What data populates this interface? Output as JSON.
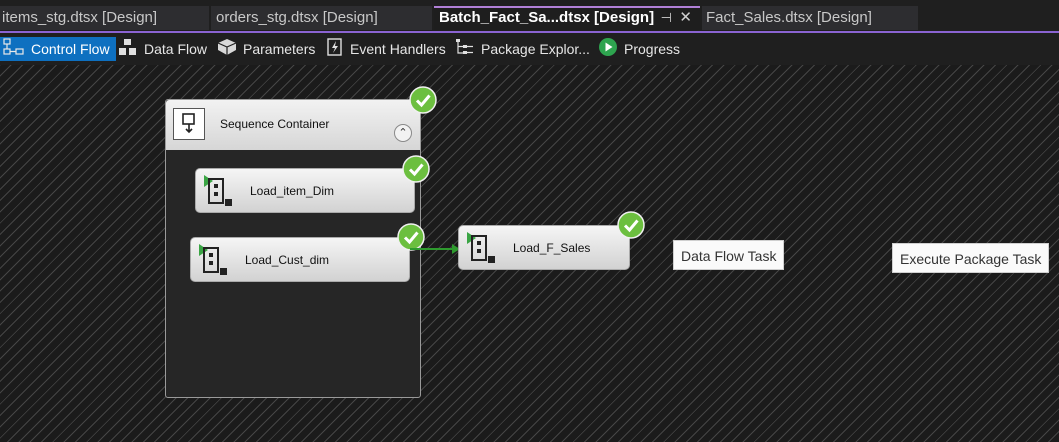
{
  "tabs": [
    {
      "label": "items_stg.dtsx [Design]"
    },
    {
      "label": "orders_stg.dtsx [Design]"
    },
    {
      "label": "Batch_Fact_Sa...dtsx [Design]",
      "pin": "⊣",
      "close": "✕"
    },
    {
      "label": "Fact_Sales.dtsx [Design]"
    }
  ],
  "toolbar": {
    "items": [
      {
        "label": "Control Flow",
        "icon": "control-flow-icon"
      },
      {
        "label": "Data Flow",
        "icon": "data-flow-icon"
      },
      {
        "label": "Parameters",
        "icon": "parameters-icon"
      },
      {
        "label": "Event Handlers",
        "icon": "event-handlers-icon"
      },
      {
        "label": "Package Explor...",
        "icon": "package-explorer-icon"
      },
      {
        "label": "Progress",
        "icon": "progress-play-icon"
      }
    ]
  },
  "canvas": {
    "container": {
      "title": "Sequence Container",
      "collapse": "⌃"
    },
    "tasks": [
      {
        "label": "Load_item_Dim"
      },
      {
        "label": "Load_Cust_dim"
      },
      {
        "label": "Load_F_Sales"
      }
    ],
    "tooltips": [
      "Data Flow Task",
      "Execute Package Task"
    ]
  },
  "colors": {
    "accent": "#0e70c0",
    "tab_indicator": "#8a63d2",
    "success": "#6cbf3f",
    "precedence": "#2e9a2e"
  }
}
